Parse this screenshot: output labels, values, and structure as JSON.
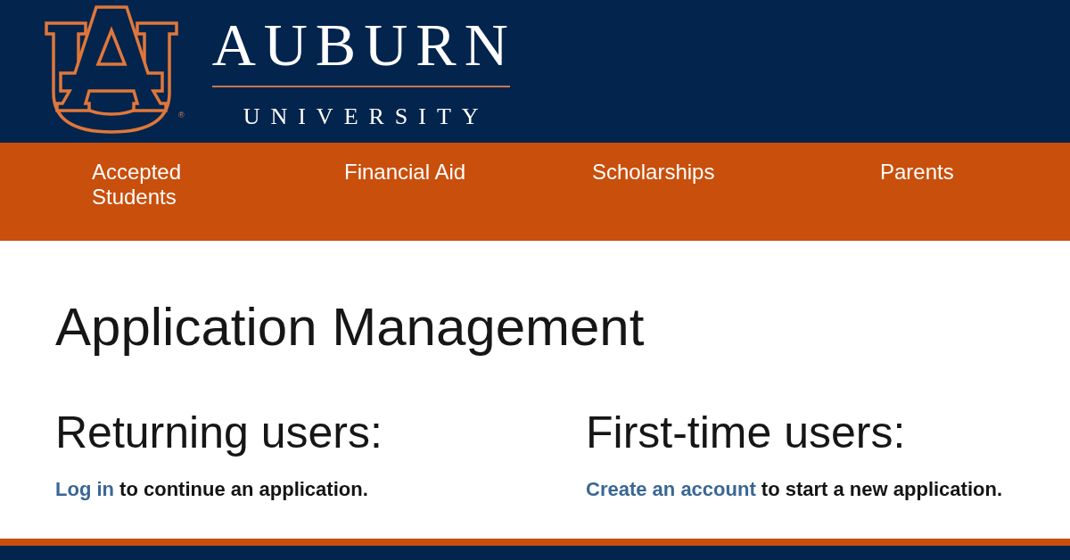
{
  "header": {
    "logo": {
      "mark": "®"
    },
    "wordmark": {
      "name": "AUBURN",
      "subtitle": "UNIVERSITY"
    }
  },
  "nav": {
    "items": [
      {
        "label": "Accepted Students"
      },
      {
        "label": "Financial Aid"
      },
      {
        "label": "Scholarships"
      },
      {
        "label": "Parents"
      }
    ]
  },
  "main": {
    "title": "Application Management",
    "sections": [
      {
        "heading": "Returning users:",
        "link": "Log in",
        "text": "to continue an application."
      },
      {
        "heading": "First-time users:",
        "link": "Create an account",
        "text": "to start a new application."
      }
    ]
  }
}
